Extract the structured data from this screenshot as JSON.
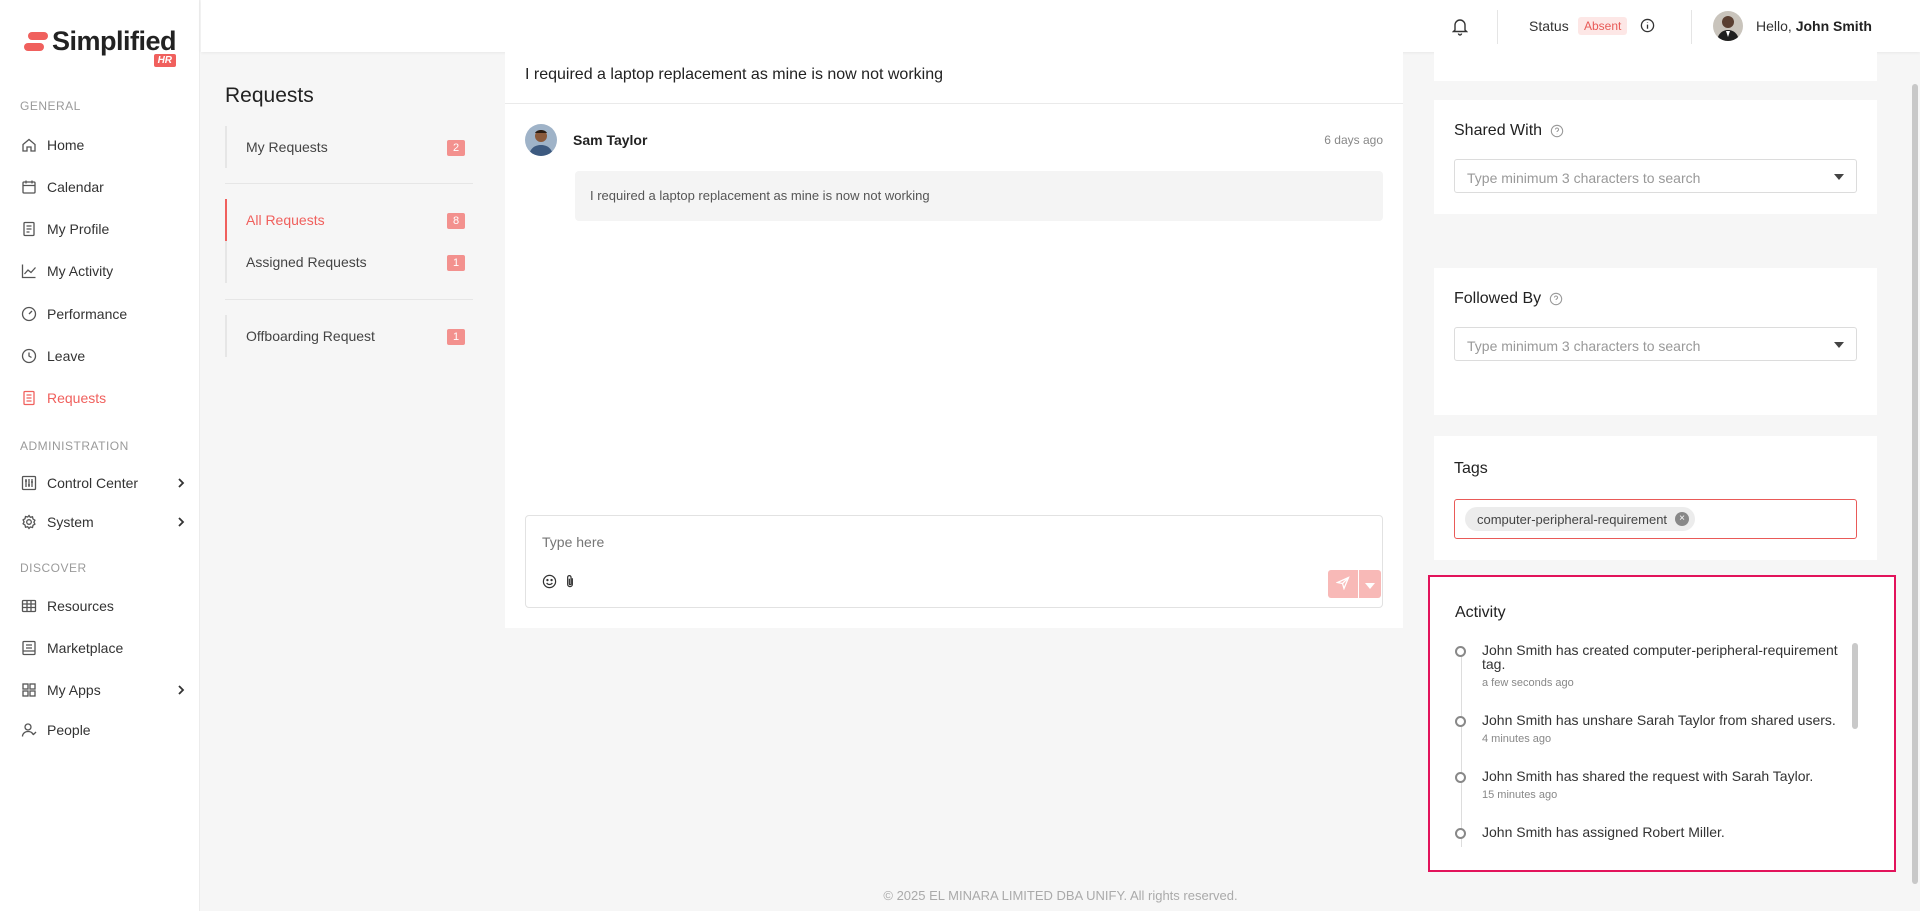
{
  "brand": {
    "name": "Simplified",
    "sub": "HR",
    "accent": "#f0605d"
  },
  "sidebar": {
    "sections": [
      "GENERAL",
      "ADMINISTRATION",
      "DISCOVER"
    ],
    "items": [
      {
        "label": "Home",
        "icon": "home-icon"
      },
      {
        "label": "Calendar",
        "icon": "calendar-icon"
      },
      {
        "label": "My Profile",
        "icon": "profile-icon"
      },
      {
        "label": "My Activity",
        "icon": "activity-chart-icon"
      },
      {
        "label": "Performance",
        "icon": "gauge-icon"
      },
      {
        "label": "Leave",
        "icon": "clock-icon"
      },
      {
        "label": "Requests",
        "icon": "requests-icon",
        "active": true
      },
      {
        "label": "Control Center",
        "icon": "sliders-icon"
      },
      {
        "label": "System",
        "icon": "gear-icon"
      },
      {
        "label": "Resources",
        "icon": "table-icon"
      },
      {
        "label": "Marketplace",
        "icon": "store-icon"
      },
      {
        "label": "My Apps",
        "icon": "apps-grid-icon"
      },
      {
        "label": "People",
        "icon": "people-icon"
      }
    ]
  },
  "header": {
    "status_label": "Status",
    "status_value": "Absent",
    "hello": "Hello,",
    "user_name": "John Smith"
  },
  "requests": {
    "title": "Requests",
    "items": [
      {
        "label": "My Requests",
        "count": "2"
      },
      {
        "label": "All Requests",
        "count": "8",
        "active": true
      },
      {
        "label": "Assigned Requests",
        "count": "1"
      },
      {
        "label": "Offboarding Request",
        "count": "1"
      }
    ]
  },
  "conversation": {
    "title": "I required a laptop replacement as mine is now not working",
    "author": "Sam Taylor",
    "time": "6 days ago",
    "message": "I required a laptop replacement as mine is now not working",
    "composer_placeholder": "Type here"
  },
  "shared_with": {
    "title": "Shared With",
    "placeholder": "Type minimum 3 characters to search"
  },
  "followed_by": {
    "title": "Followed By",
    "placeholder": "Type minimum 3 characters to search"
  },
  "tags": {
    "title": "Tags",
    "items": [
      "computer-peripheral-requirement"
    ]
  },
  "activity": {
    "title": "Activity",
    "items": [
      {
        "text": "John Smith has created computer-peripheral-requirement tag.",
        "time": "a few seconds ago"
      },
      {
        "text": "John Smith has unshare Sarah Taylor from shared users.",
        "time": "4 minutes ago"
      },
      {
        "text": "John Smith has shared the request with Sarah Taylor.",
        "time": "15 minutes ago"
      },
      {
        "text": "John Smith has assigned Robert Miller.",
        "time": ""
      }
    ]
  },
  "footer": {
    "text": "© 2025 EL MINARA LIMITED DBA UNIFY. All rights reserved."
  }
}
